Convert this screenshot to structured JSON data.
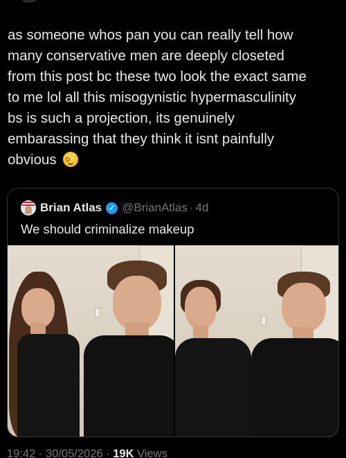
{
  "post": {
    "lines": [
      "as someone whos pan you can really tell how",
      "many conservative men are deeply closeted",
      "from this post bc these two look the exact same",
      "to me lol all this misogynistic hypermasculinity",
      "bs is such a projection, its genuinely",
      "embarassing that they think it isnt painfully",
      "obvious"
    ],
    "emoji": "face-with-spiral-eyes-emoji"
  },
  "quote": {
    "name": "Brian Atlas",
    "handle": "@BrianAtlas",
    "dot": "·",
    "time": "4d",
    "text": "We should criminalize makeup",
    "verified_color": "#1d9bf0"
  },
  "footer": {
    "time": "19:42",
    "sep1": " · ",
    "date": "30/05/2026",
    "sep2": " · ",
    "views": "19K",
    "views_label": " Views"
  },
  "colors": {
    "background": "#000000",
    "text": "#e7e9ea",
    "muted": "#71767b",
    "border": "#2f3336"
  }
}
